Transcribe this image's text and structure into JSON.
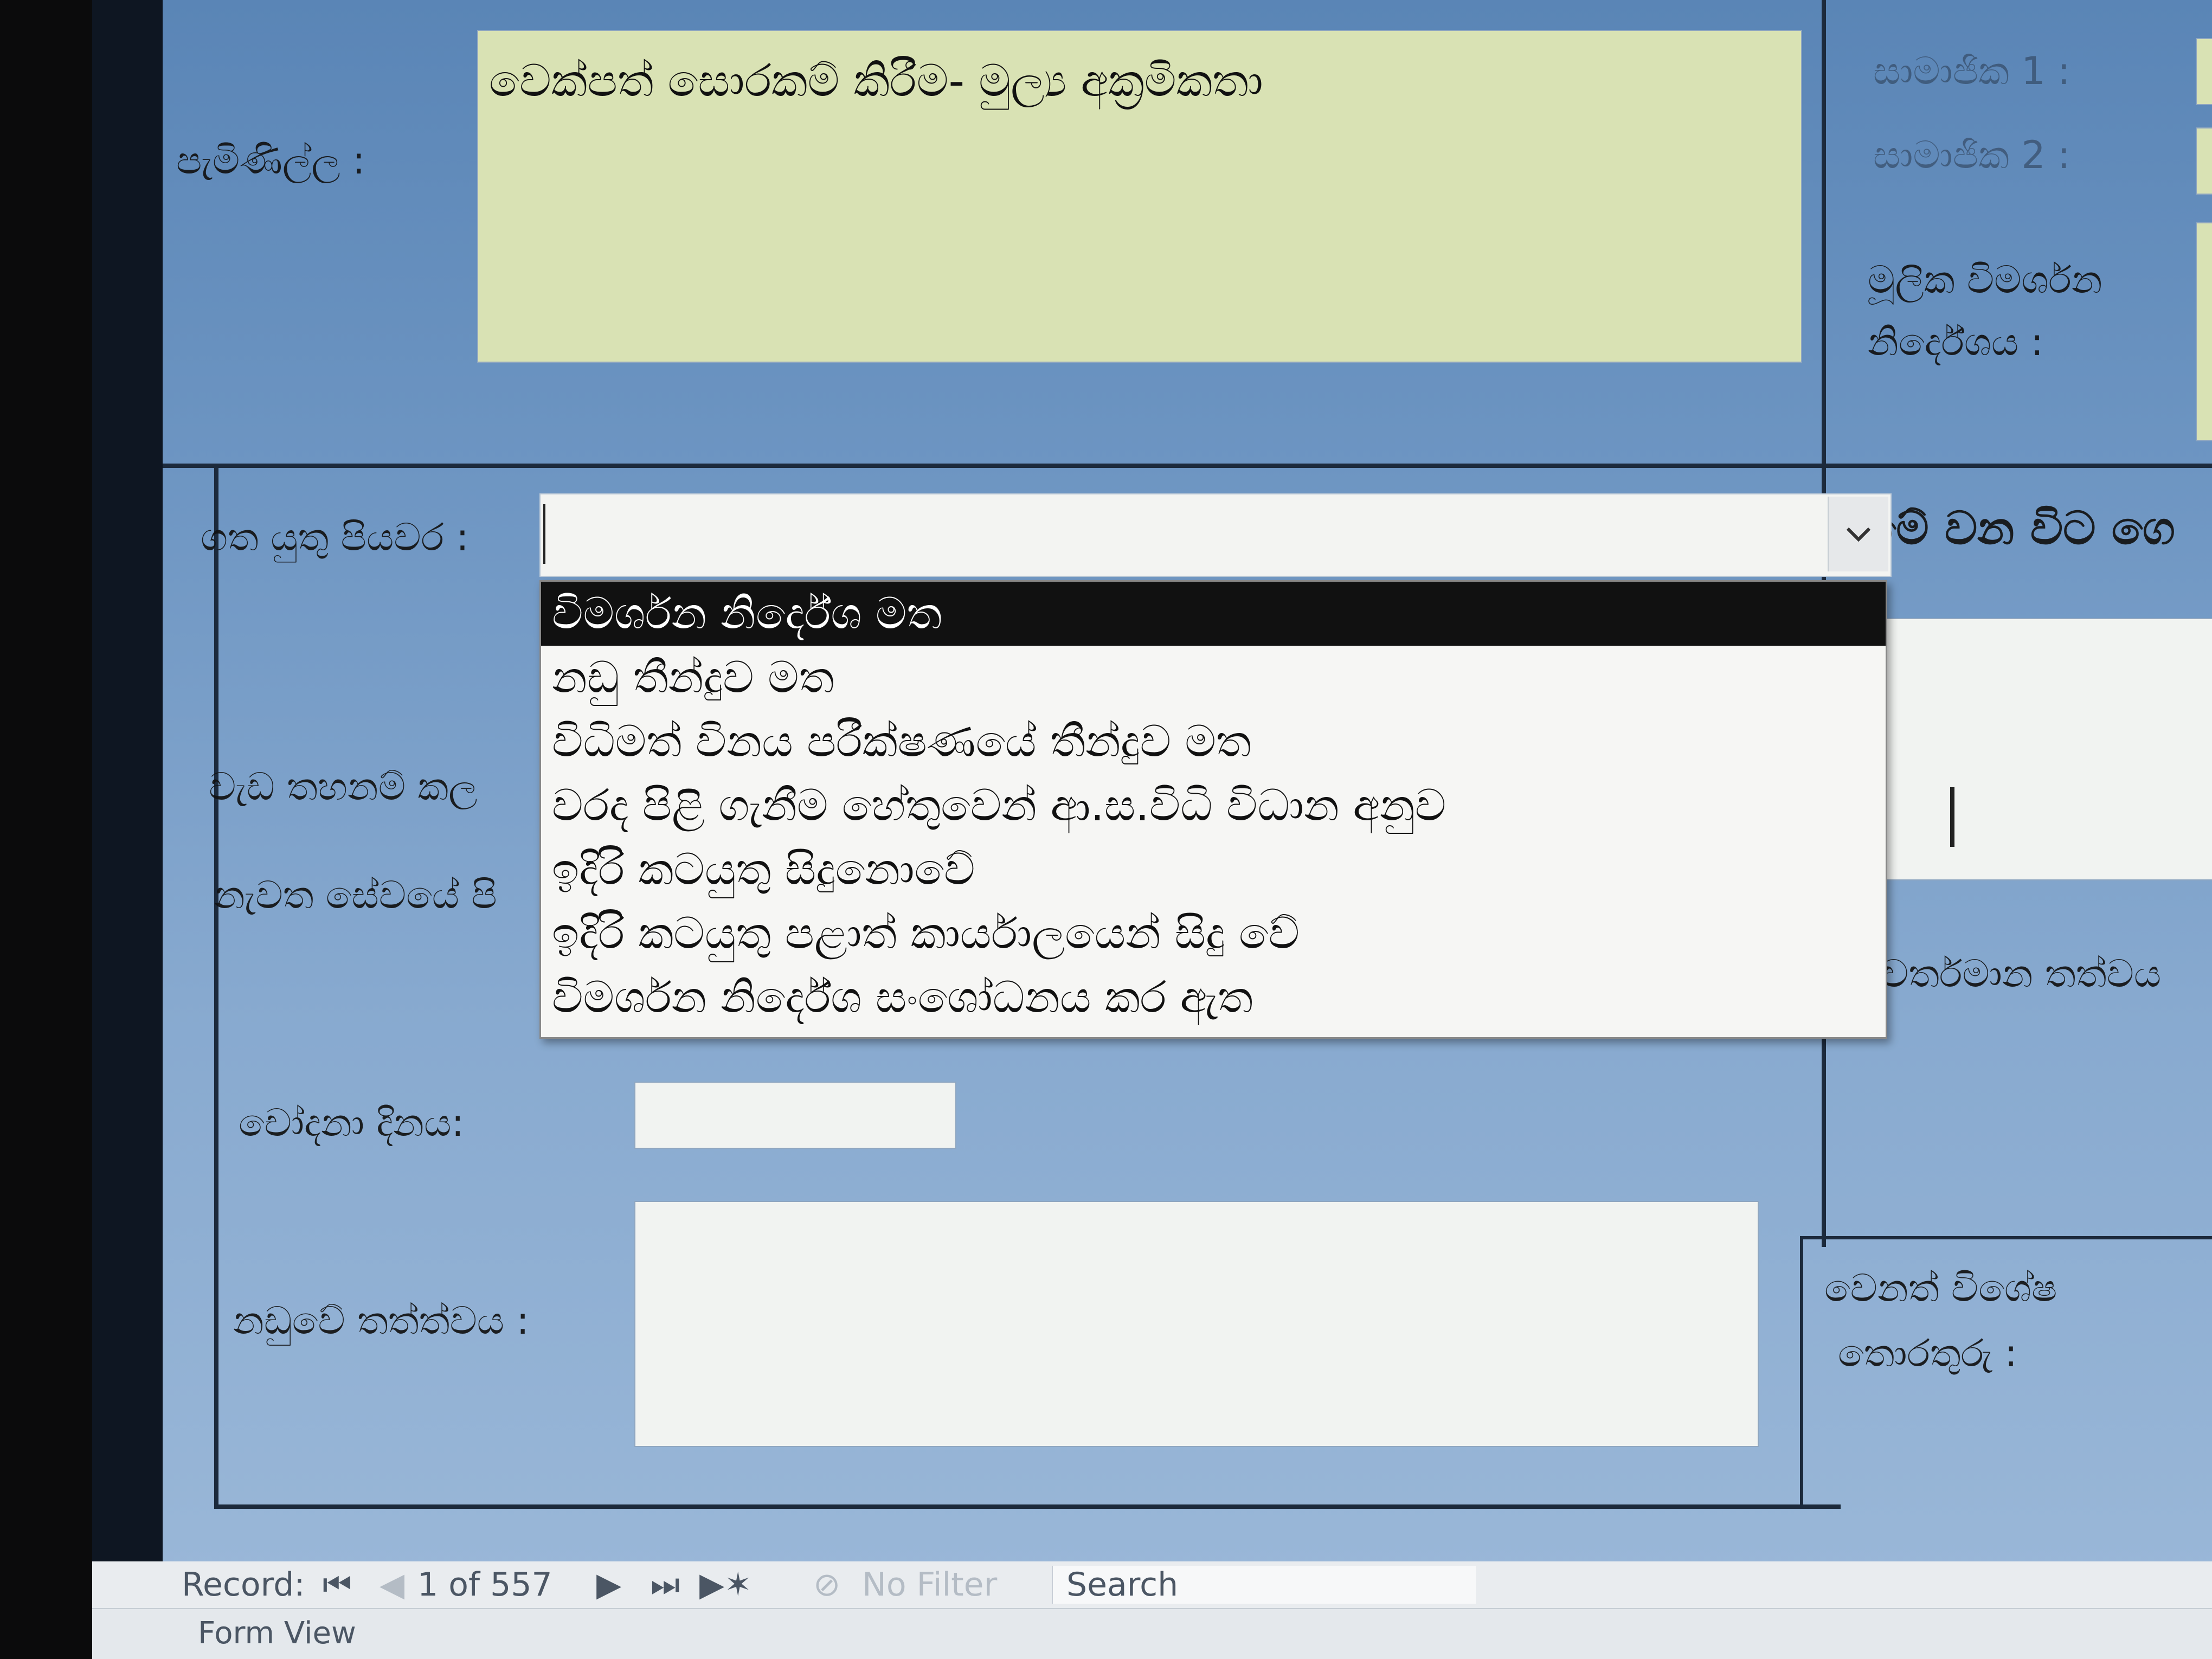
{
  "form": {
    "complaint_label": "පැමිණිල්ල :",
    "complaint_topic": "වෙක්පත් සොරකම් කිරීම- මුල්‍ය අක්‍රමිකතා",
    "member1_label": "සාමාජික 1 :",
    "member2_label": "සාමාජික 2 :",
    "prelim_line1": "මූලික විමර්ශන",
    "prelim_line2": "නිර්දේශය :",
    "action_label": "ගත යුතු පියවර :",
    "action_value": "",
    "right_heading": "මේ වන විට ගෙ",
    "work_label": "වැඩ තහනම් කල",
    "reinstate_label": "නැවත සේවයේ පි",
    "current_status_label": "වර්තමාන තත්වය",
    "charge_date_label": "චෝදනා දිනය:",
    "charge_date_value": "",
    "case_status_label": "නඩුවේ තත්ත්වය :",
    "other_line1": "වෙනත් විශේෂ",
    "other_line2": "තොරතුරු :"
  },
  "dropdown": {
    "options": [
      "විමර්ශන නිර්දේශ මත",
      "නඩු තීන්දුව මත",
      "විධිමත් විනය පරීක්ෂණයේ තීන්දුව මත",
      "වරද පිළි ගැනීම හේතුවෙන් ආ.ස.විධි විධාන අනුව",
      "ඉදිරි කටයුතු සිදුනොවේ",
      "ඉදිරි කටයුතු පළාත් කාර්යාලයෙන් සිදු වේ",
      "විමර්ශන නිර්දේශ සංශෝධනය කර ඇත"
    ],
    "selected_index": 0
  },
  "statusbar": {
    "record_label": "Record:",
    "record_position": "1 of 557",
    "filter_label": "No Filter",
    "search_label": "Search",
    "view_label": "Form View"
  }
}
